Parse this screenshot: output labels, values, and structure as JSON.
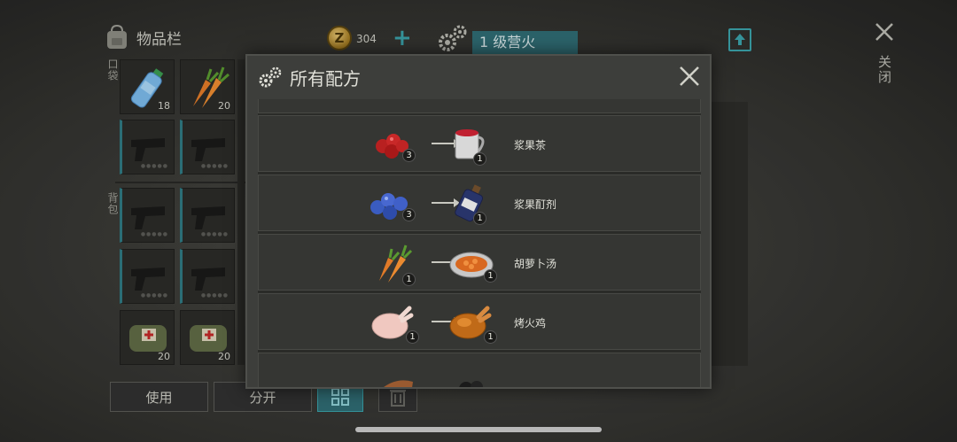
{
  "inventory": {
    "title": "物品栏",
    "pocket_label": "口袋",
    "backpack_label": "背包",
    "slots": [
      {
        "item": "water-bottle",
        "count": "18"
      },
      {
        "item": "carrot",
        "count": "20"
      }
    ],
    "medkit_counts": [
      "20",
      "20"
    ]
  },
  "currency": {
    "count": "304",
    "coin_glyph": "Z"
  },
  "workbench": {
    "level_label": "1 级营火"
  },
  "close": {
    "label": "关闭"
  },
  "bottom_bar": {
    "use_label": "使用",
    "split_label": "分开"
  },
  "modal": {
    "title": "所有配方",
    "recipes": [
      {
        "input_qty": "3",
        "output_qty": "1",
        "name": "浆果茶",
        "input": "red-berries",
        "output": "tea-cup"
      },
      {
        "input_qty": "3",
        "output_qty": "1",
        "name": "浆果酊剂",
        "input": "blueberries",
        "output": "tincture-bottle"
      },
      {
        "input_qty": "1",
        "output_qty": "1",
        "name": "胡萝卜汤",
        "input": "carrots",
        "output": "carrot-stew"
      },
      {
        "input_qty": "1",
        "output_qty": "1",
        "name": "烤火鸡",
        "input": "raw-chicken",
        "output": "roast-chicken"
      }
    ]
  },
  "colors": {
    "accent": "#2f6b72",
    "accent_bright": "#3aa0a8",
    "panel": "#3d3e3b",
    "row": "#353633"
  }
}
